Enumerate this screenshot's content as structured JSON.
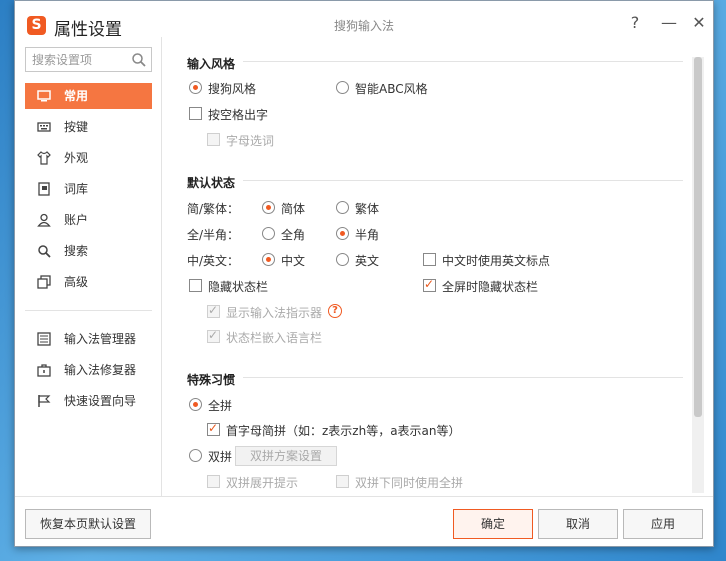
{
  "window": {
    "title": "属性设置",
    "app_name": "搜狗输入法",
    "help_label": "?",
    "minimize_label": "—",
    "close_label": "✕"
  },
  "sidebar": {
    "search_placeholder": "搜索设置项",
    "items": [
      {
        "label": "常用",
        "icon": "monitor-icon",
        "active": true
      },
      {
        "label": "按键",
        "icon": "keyboard-icon"
      },
      {
        "label": "外观",
        "icon": "shirt-icon"
      },
      {
        "label": "词库",
        "icon": "book-icon"
      },
      {
        "label": "账户",
        "icon": "user-icon"
      },
      {
        "label": "搜索",
        "icon": "search-icon"
      },
      {
        "label": "高级",
        "icon": "advanced-icon"
      }
    ],
    "tools": [
      {
        "label": "输入法管理器",
        "icon": "list-icon"
      },
      {
        "label": "输入法修复器",
        "icon": "toolbox-icon"
      },
      {
        "label": "快速设置向导",
        "icon": "flag-icon"
      }
    ]
  },
  "sections": {
    "input_style": {
      "title": "输入风格",
      "sogou_style": "搜狗风格",
      "abc_style": "智能ABC风格",
      "space_output": "按空格出字",
      "letter_select": "字母选词"
    },
    "default_state": {
      "title": "默认状态",
      "simp_trad_label": "简/繁体：",
      "simplified": "简体",
      "traditional": "繁体",
      "width_label": "全/半角：",
      "full_width": "全角",
      "half_width": "半角",
      "cn_en_label": "中/英文：",
      "chinese": "中文",
      "english": "英文",
      "cn_use_en_punct": "中文时使用英文标点",
      "hide_statusbar": "隐藏状态栏",
      "fullscreen_hide_statusbar": "全屏时隐藏状态栏",
      "show_indicator": "显示输入法指示器",
      "embed_language_bar": "状态栏嵌入语言栏"
    },
    "special_habits": {
      "title": "特殊习惯",
      "quanpin": "全拼",
      "initial_abbrev": "首字母简拼（如：z表示zh等，a表示an等）",
      "shuangpin": "双拼",
      "shuangpin_scheme_button": "双拼方案设置",
      "shuangpin_expand_hint": "双拼展开提示",
      "shuangpin_use_quanpin": "双拼下同时使用全拼"
    }
  },
  "footer": {
    "restore_default": "恢复本页默认设置",
    "ok": "确定",
    "cancel": "取消",
    "apply": "应用"
  },
  "colors": {
    "accent": "#f05a22",
    "active_nav": "#f57641"
  }
}
